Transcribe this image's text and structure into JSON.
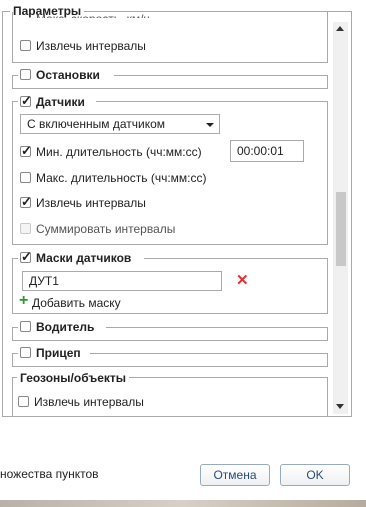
{
  "dialog": {
    "title": "Параметры",
    "partial_top_label": "Макс. скорость, км/ч",
    "top_extract_label": "Извлечь интервалы",
    "groups": {
      "stops": {
        "label": "Остановки",
        "checked": false
      },
      "sensors": {
        "label": "Датчики",
        "checked": true,
        "select_value": "С включенным датчиком",
        "min_duration_label": "Мин. длительность (чч:мм:сс)",
        "min_duration_value": "00:00:01",
        "max_duration_label": "Макс. длительность (чч:мм:сс)",
        "extract_label": "Извлечь интервалы",
        "sum_label": "Суммировать интервалы"
      },
      "sensor_masks": {
        "label": "Маски датчиков",
        "checked": true,
        "mask_value": "ДУТ1",
        "add_label": "Добавить маску"
      },
      "driver": {
        "label": "Водитель",
        "checked": false
      },
      "trailer": {
        "label": "Прицеп",
        "checked": false
      },
      "geozones": {
        "label": "Геозоны/объекты",
        "extract_label": "Извлечь интервалы"
      }
    }
  },
  "footer": {
    "left_text": "ножества пунктов",
    "cancel_label": "Отмена",
    "ok_label": "OK"
  },
  "colors": {
    "delete": "#d33",
    "add": "#2a9a2a",
    "button_text": "#2a4a7a"
  },
  "icons": [
    "scroll-up-icon",
    "scroll-down-icon",
    "chevron-down-icon",
    "delete-icon",
    "plus-icon"
  ]
}
